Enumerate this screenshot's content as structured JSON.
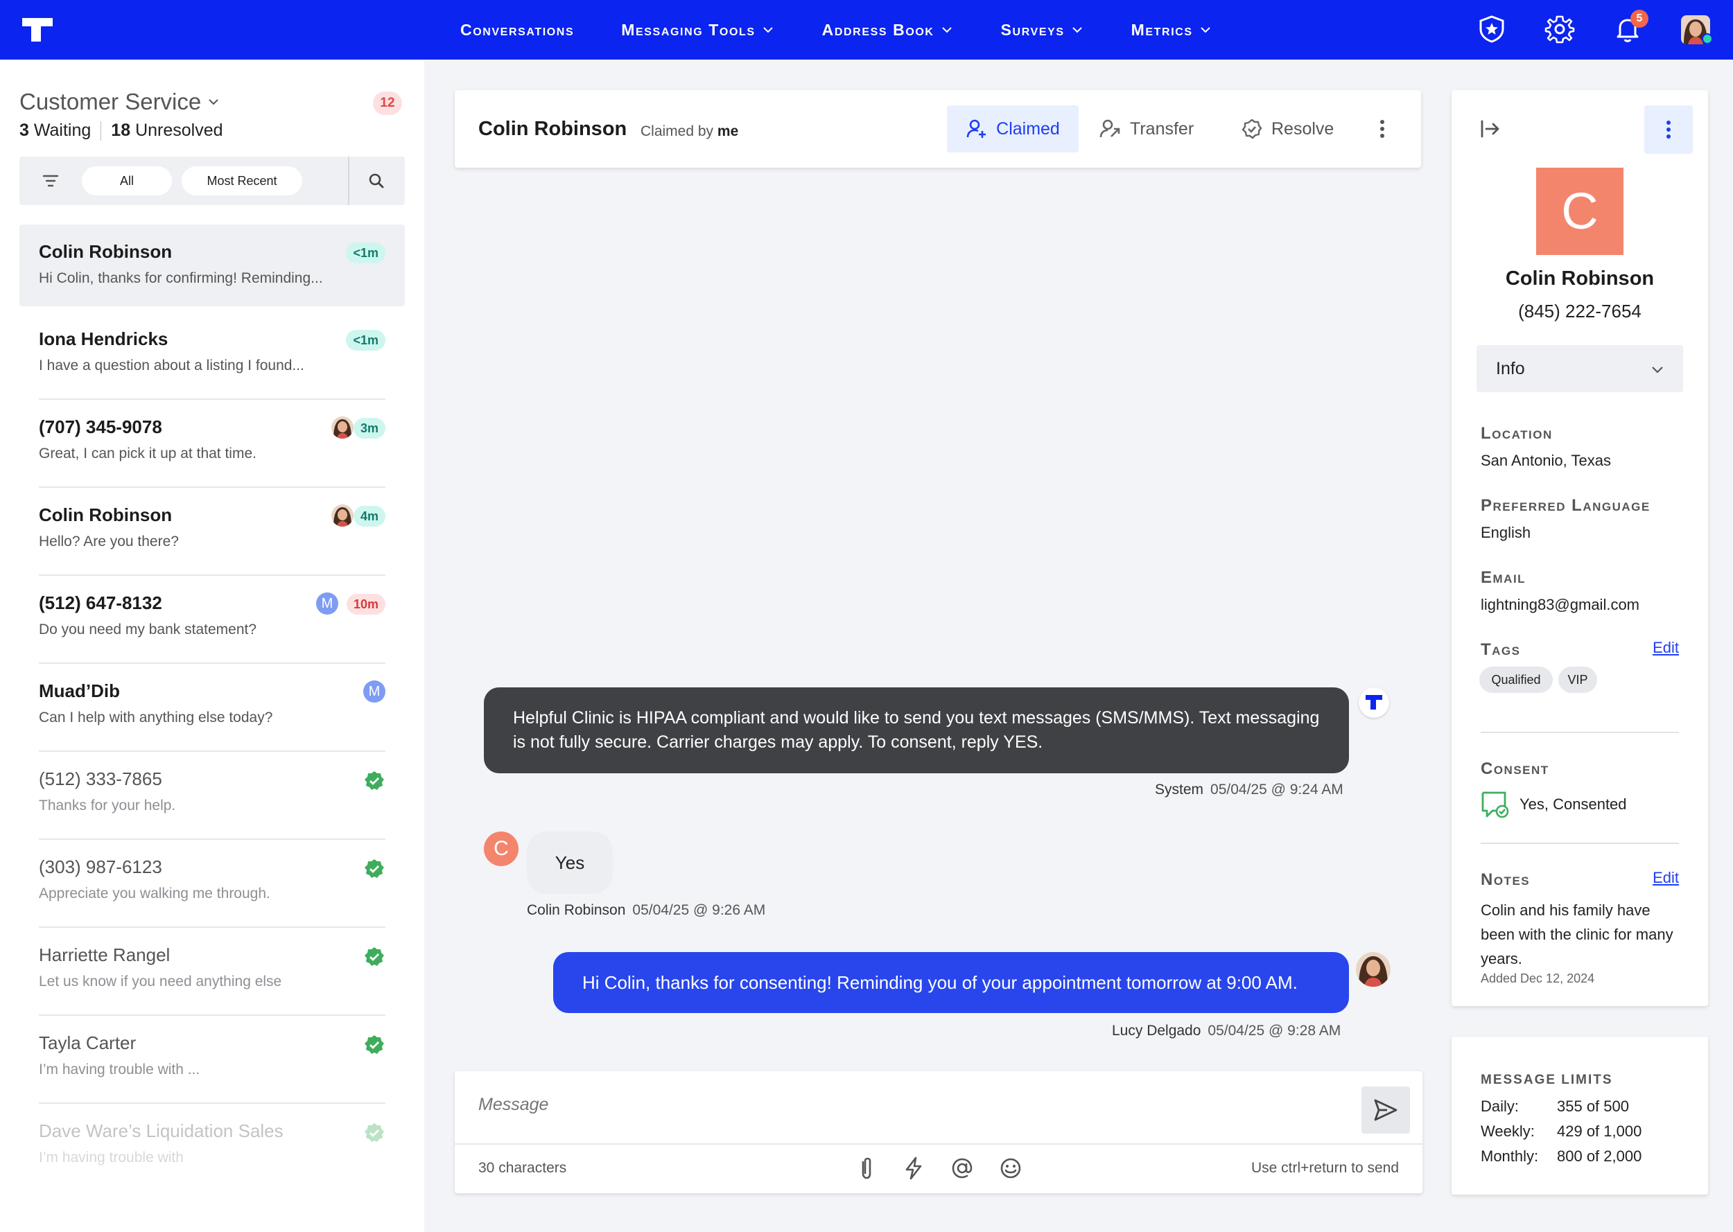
{
  "nav": {
    "items": [
      {
        "label": "Conversations",
        "dropdown": false
      },
      {
        "label": "Messaging Tools",
        "dropdown": true
      },
      {
        "label": "Address Book",
        "dropdown": true
      },
      {
        "label": "Surveys",
        "dropdown": true
      },
      {
        "label": "Metrics",
        "dropdown": true
      }
    ],
    "notification_count": "5"
  },
  "inbox": {
    "title": "Customer Service",
    "count_badge": "12",
    "waiting": "3",
    "waiting_label": "Waiting",
    "unresolved": "18",
    "unresolved_label": "Unresolved",
    "filters": [
      "All",
      "Most Recent"
    ]
  },
  "conversations": [
    {
      "name": "Colin Robinson",
      "preview": "Hi Colin, thanks for confirming! Reminding...",
      "time": "<1m"
    },
    {
      "name": "Iona Hendricks",
      "preview": "I have a question about a listing I found...",
      "time": "<1m"
    },
    {
      "name": "(707) 345-9078",
      "preview": "Great, I can pick it up at that time.",
      "time": "3m"
    },
    {
      "name": "Colin Robinson",
      "preview": "Hello? Are you there?",
      "time": "4m"
    },
    {
      "name": "(512) 647-8132",
      "preview": "Do you need my bank statement?",
      "time": "10m",
      "avatar_letter": "M"
    },
    {
      "name": "Muad’Dib",
      "preview": "Can I help with anything else today?",
      "avatar_letter": "M"
    },
    {
      "name": "(512) 333-7865",
      "preview": "Thanks for your help."
    },
    {
      "name": "(303) 987-6123",
      "preview": "Appreciate you walking me through."
    },
    {
      "name": "Harriette Rangel",
      "preview": "Let us know if you need anything else"
    },
    {
      "name": "Tayla Carter",
      "preview": "I’m having trouble with ..."
    },
    {
      "name": "Dave Ware’s Liquidation Sales",
      "preview": "I’m having trouble with"
    }
  ],
  "chat": {
    "contact_name": "Colin Robinson",
    "claimed_by_prefix": "Claimed by",
    "claimed_by": "me",
    "actions": {
      "claimed": "Claimed",
      "transfer": "Transfer",
      "resolve": "Resolve"
    },
    "messages": [
      {
        "text": "Helpful Clinic is HIPAA compliant and would like to send you text messages (SMS/MMS). Text messaging is not fully secure. Carrier charges may apply. To consent, reply YES.",
        "sender": "System",
        "timestamp": "05/04/25 @ 9:24 AM"
      },
      {
        "text": "Yes",
        "sender": "Colin Robinson",
        "timestamp": "05/04/25 @ 9:26 AM",
        "avatar_letter": "C"
      },
      {
        "text": "Hi Colin, thanks for consenting! Reminding you of your appointment tomorrow at 9:00 AM.",
        "sender": "Lucy Delgado",
        "timestamp": "05/04/25 @ 9:28 AM"
      }
    ],
    "composer": {
      "placeholder": "Message",
      "char_count": "30",
      "char_label": "characters",
      "hint": "Use ctrl+return to send"
    }
  },
  "profile": {
    "avatar_letter": "C",
    "name": "Colin Robinson",
    "phone": "(845) 222-7654",
    "section_select": "Info",
    "location_label": "Location",
    "location": "San Antonio, Texas",
    "language_label": "Preferred Language",
    "language": "English",
    "email_label": "Email",
    "email": "lightning83@gmail.com",
    "tags_label": "Tags",
    "edit_label": "Edit",
    "tags": [
      "Qualified",
      "VIP"
    ],
    "consent_label": "Consent",
    "consent_value": "Yes, Consented",
    "notes_label": "Notes",
    "notes": "Colin and his family have been with the clinic for many years.",
    "notes_date": "Added Dec 12, 2024"
  },
  "limits": {
    "title": "MESSAGE LIMITS",
    "rows": [
      {
        "label": "Daily:",
        "value": "355 of 500"
      },
      {
        "label": "Weekly:",
        "value": "429 of 1,000"
      },
      {
        "label": "Monthly:",
        "value": "800 of 2,000"
      }
    ]
  },
  "colors": {
    "brand": "#0b24ef",
    "accent": "#2846ec",
    "avatar": "#f3856d",
    "success": "#3fae5c"
  }
}
